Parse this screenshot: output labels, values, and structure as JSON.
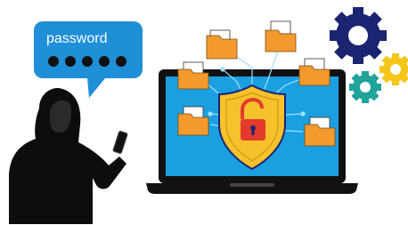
{
  "speech_bubble": {
    "label": "password",
    "masked_dots": 5
  },
  "colors": {
    "bubble": "#1f8fd8",
    "screen": "#1aa0e0",
    "laptop_frame": "#111111",
    "folder": "#f29a2e",
    "shield": "#f6c12b",
    "lock": "#e23b2e",
    "gear_navy": "#1b2470",
    "gear_yellow": "#f5c518",
    "gear_teal": "#1fa39a",
    "hacker": "#0d0d0d"
  },
  "icons": [
    "hacker-figure",
    "smartphone-icon",
    "laptop-icon",
    "shield-icon",
    "unlocked-padlock-icon",
    "folder-icon",
    "gear-icon"
  ]
}
